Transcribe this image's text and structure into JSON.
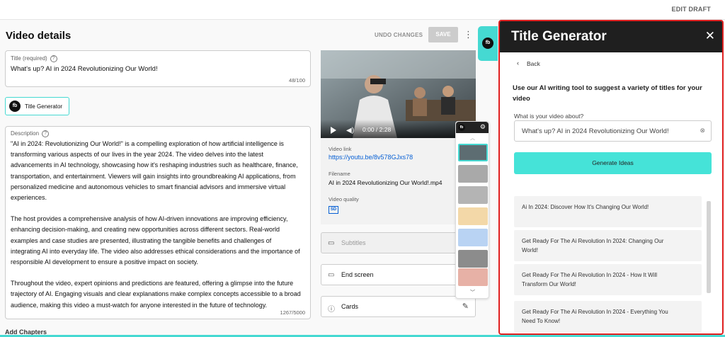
{
  "header": {
    "edit_draft": "EDIT DRAFT"
  },
  "details": {
    "page_title": "Video details",
    "undo_label": "UNDO CHANGES",
    "save_label": "SAVE",
    "more_icon": "⋮",
    "title_field": {
      "label": "Title (required)",
      "value": "What's up? AI in 2024 Revolutionizing Our World!",
      "count": "48/100"
    },
    "title_generator_button": {
      "label": "Title Generator",
      "logo": "fb"
    },
    "description_field": {
      "label": "Description",
      "paragraphs": [
        "\"AI in 2024: Revolutionizing Our World!\" is a compelling exploration of how artificial intelligence is transforming various aspects of our lives in the year 2024. The video delves into the latest advancements in AI technology, showcasing how it's reshaping industries such as healthcare, finance, transportation, and entertainment. Viewers will gain insights into groundbreaking AI applications, from personalized medicine and autonomous vehicles to smart financial advisors and immersive virtual experiences.",
        "The host provides a comprehensive analysis of how AI-driven innovations are improving efficiency, enhancing decision-making, and creating new opportunities across different sectors. Real-world examples and case studies are presented, illustrating the tangible benefits and challenges of integrating AI into everyday life. The video also addresses ethical considerations and the importance of responsible AI development to ensure a positive impact on society.",
        "Throughout the video, expert opinions and predictions are featured, offering a glimpse into the future trajectory of AI. Engaging visuals and clear explanations make complex concepts accessible to a broad audience, making this video a must-watch for anyone interested in the future of technology."
      ],
      "count": "1267/5000"
    },
    "add_chapters": "Add Chapters"
  },
  "video": {
    "time": "0:00 / 2:28",
    "link_label": "Video link",
    "link": "https://youtu.be/8v578GJxs78",
    "filename_label": "Filename",
    "filename": "AI in 2024 Revolutionizing Our World!.mp4",
    "quality_label": "Video quality",
    "quality_badge": "SD"
  },
  "side_cards": [
    {
      "label": "Subtitles",
      "icon": "▭"
    },
    {
      "label": "End screen",
      "icon": "▭"
    },
    {
      "label": "Cards",
      "icon": "ⓘ"
    }
  ],
  "thumbstrip": {
    "logo": "fb",
    "gear_icon": "⚙",
    "up_icon": "︿",
    "down_icon": "﹀"
  },
  "panel": {
    "title": "Title Generator",
    "close_icon": "✕",
    "back_chevron": "‹",
    "back_label": "Back",
    "intro": "Use our AI writing tool to suggest a variety of titles for your video",
    "about_label": "What is your video about?",
    "about_value": "What's up? AI in 2024 Revolutionizing Our World!",
    "clear_icon": "⊗",
    "generate_label": "Generate Ideas",
    "ideas": [
      "Ai In 2024: Discover How It's Changing Our World!",
      "Get Ready For The Ai Revolution In 2024: Changing Our World!",
      "Get Ready For The Ai Revolution In 2024 - How It Will Transform Our World!",
      "Get Ready For The Ai Revolution In 2024 - Everything You Need To Know!"
    ]
  },
  "colors": {
    "accent_teal": "#45d9d2",
    "panel_border": "#e02020",
    "link_blue": "#065fd4"
  }
}
